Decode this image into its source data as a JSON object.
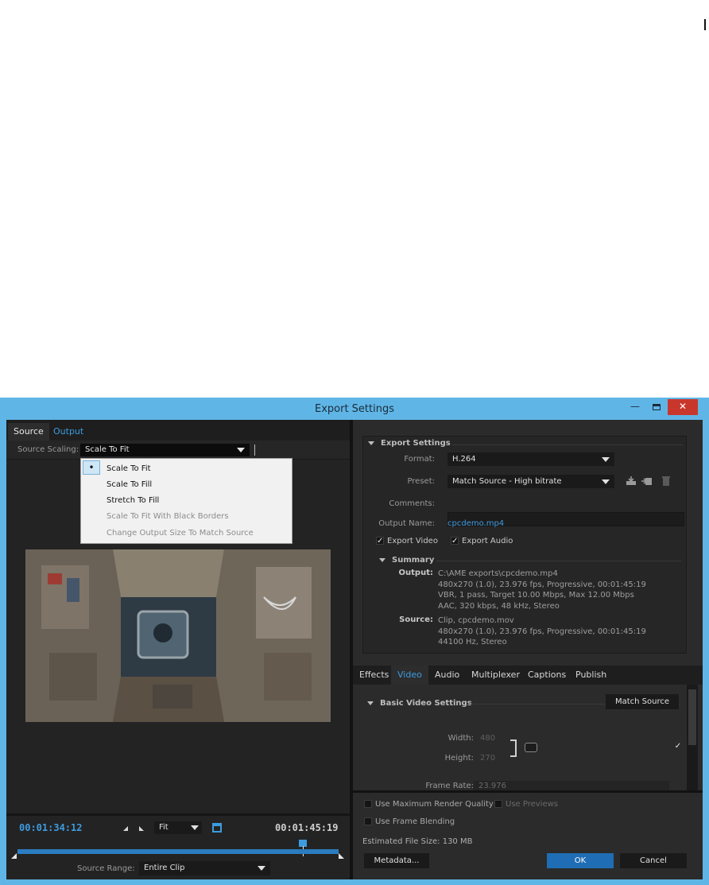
{
  "window": {
    "title": "Export Settings",
    "minimize": "—",
    "close": "✕"
  },
  "left": {
    "tabs": [
      "Source",
      "Output"
    ],
    "source_scaling_label": "Source Scaling:",
    "source_scaling_value": "Scale To Fit",
    "scaling_options": [
      {
        "label": "Scale To Fit",
        "selected": true,
        "enabled": true
      },
      {
        "label": "Scale To Fill",
        "selected": false,
        "enabled": true
      },
      {
        "label": "Stretch To Fill",
        "selected": false,
        "enabled": true
      },
      {
        "label": "Scale To Fit With Black Borders",
        "selected": false,
        "enabled": false
      },
      {
        "label": "Change Output Size To Match Source",
        "selected": false,
        "enabled": false
      }
    ],
    "current_time": "00:01:34:12",
    "end_time": "00:01:45:19",
    "zoom": "Fit",
    "source_range_label": "Source Range:",
    "source_range_value": "Entire Clip"
  },
  "export_settings": {
    "header": "Export Settings",
    "format_label": "Format:",
    "format_value": "H.264",
    "preset_label": "Preset:",
    "preset_value": "Match Source - High bitrate",
    "comments_label": "Comments:",
    "output_name_label": "Output Name:",
    "output_name_value": "cpcdemo.mp4",
    "export_video_label": "Export Video",
    "export_video": true,
    "export_audio_label": "Export Audio",
    "export_audio": true,
    "summary": {
      "header": "Summary",
      "output_key": "Output:",
      "output_lines": [
        "C:\\AME exports\\cpcdemo.mp4",
        "480x270 (1.0), 23.976 fps, Progressive, 00:01:45:19",
        "VBR, 1 pass, Target 10.00 Mbps, Max 12.00 Mbps",
        "AAC, 320 kbps, 48 kHz, Stereo"
      ],
      "source_key": "Source:",
      "source_lines": [
        "Clip, cpcdemo.mov",
        "480x270 (1.0), 23.976 fps, Progressive, 00:01:45:19",
        "44100 Hz, Stereo"
      ]
    }
  },
  "tabs_right": [
    {
      "label": "Effects",
      "active": false
    },
    {
      "label": "Video",
      "active": true
    },
    {
      "label": "Audio",
      "active": false
    },
    {
      "label": "Multiplexer",
      "active": false
    },
    {
      "label": "Captions",
      "active": false
    },
    {
      "label": "Publish",
      "active": false
    }
  ],
  "video": {
    "header": "Basic Video Settings",
    "match_source": "Match Source",
    "width_label": "Width:",
    "width_value": "480",
    "height_label": "Height:",
    "height_value": "270",
    "frame_rate_label": "Frame Rate:",
    "frame_rate_value": "23.976"
  },
  "bottom": {
    "max_render_label": "Use Maximum Render Quality",
    "use_previews_label": "Use Previews",
    "frame_blending_label": "Use Frame Blending",
    "est_size_label": "Estimated File Size:",
    "est_size_value": "130 MB",
    "metadata_btn": "Metadata...",
    "ok_btn": "OK",
    "cancel_btn": "Cancel"
  },
  "colors": {
    "accent": "#3d9be0",
    "titlebar": "#5fb6e6",
    "close": "#c9372c"
  }
}
